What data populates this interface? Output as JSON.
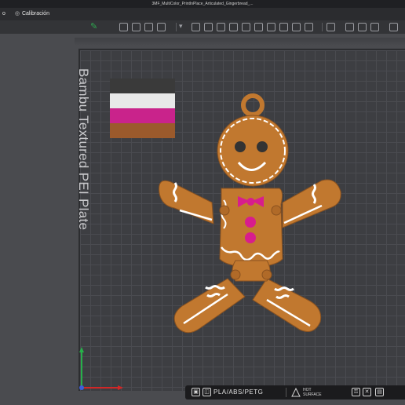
{
  "window": {
    "title": "3MF_MultiColor_PrintInPlace_Articulated_Gingerbread_..."
  },
  "tabs": [
    {
      "label": "o",
      "icon": ""
    },
    {
      "label": "Calibración",
      "icon": "target-icon"
    }
  ],
  "plate": {
    "label": "Bambu Textured PEI Plate"
  },
  "swatches": [
    "#3a3a3a",
    "#e8e8e8",
    "#c9238b",
    "#9b5a2c"
  ],
  "colors": {
    "gingerbread": "#c1782f",
    "icing": "#ffffff",
    "buttons": "#d81d8d",
    "eyes": "#333333",
    "accent": "#2ea84f"
  },
  "bottombar": {
    "filament": "PLA/ABS/PETG",
    "surface_line1": "HOT",
    "surface_line2": "SURFACE"
  }
}
